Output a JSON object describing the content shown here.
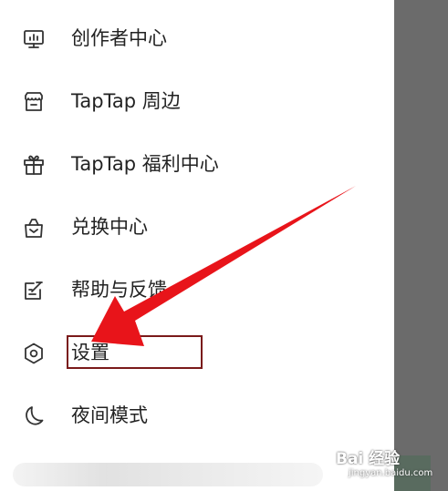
{
  "drawer": {
    "items": [
      {
        "label": "创作者中心",
        "icon": "monitor-chart-icon"
      },
      {
        "label": "TapTap 周边",
        "icon": "store-icon"
      },
      {
        "label": "TapTap 福利中心",
        "icon": "gift-icon"
      },
      {
        "label": "兑换中心",
        "icon": "redeem-bag-icon"
      },
      {
        "label": "帮助与反馈",
        "icon": "edit-note-icon"
      },
      {
        "label": "设置",
        "icon": "settings-hexagon-icon"
      },
      {
        "label": "夜间模式",
        "icon": "moon-icon"
      }
    ]
  },
  "annotation": {
    "highlight_color": "#7a1a1a",
    "arrow_color": "#e8141a"
  },
  "watermark": {
    "text": "Bai 经验",
    "sub": "jingyan.baidu.com"
  }
}
